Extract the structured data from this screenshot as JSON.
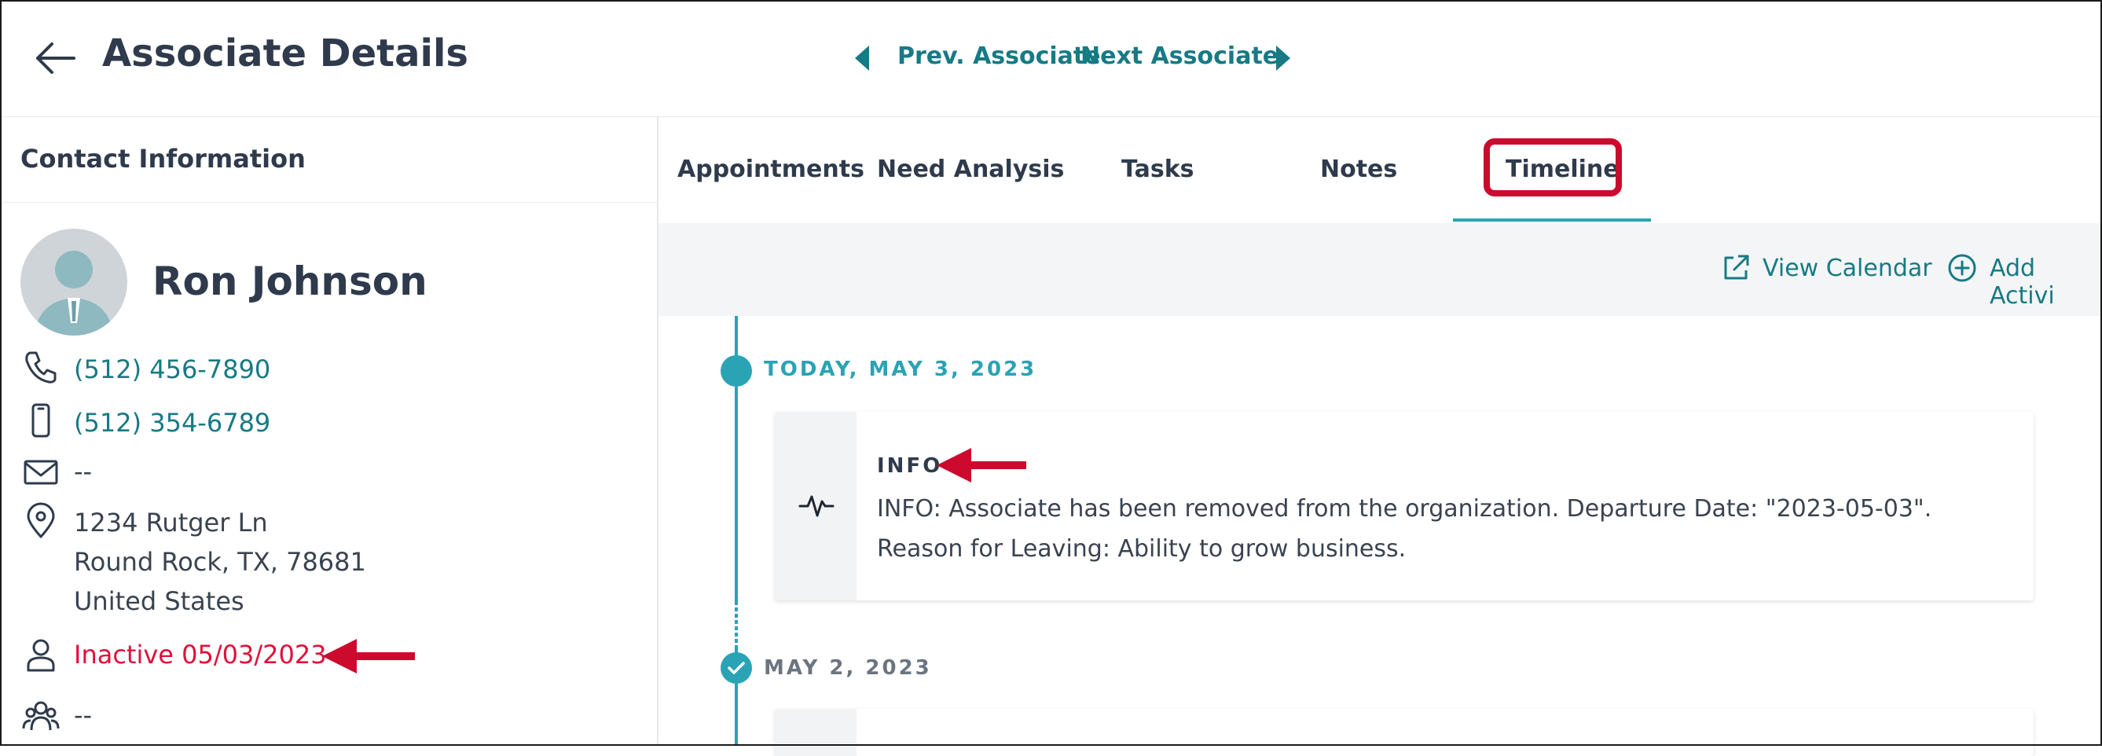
{
  "header": {
    "title": "Associate Details",
    "prev_label": "Prev. Associate",
    "next_label": "Next Associate"
  },
  "sidebar": {
    "heading": "Contact Information",
    "name": "Ron Johnson",
    "phone_primary": "(512) 456-7890",
    "phone_mobile": "(512) 354-6789",
    "email": "--",
    "address_line1": "1234 Rutger Ln",
    "address_line2": "Round Rock, TX, 78681",
    "address_line3": "United States",
    "status": "Inactive 05/03/2023",
    "team": "--"
  },
  "tabs": [
    {
      "label": "Appointments"
    },
    {
      "label": "Need Analysis"
    },
    {
      "label": "Tasks"
    },
    {
      "label": "Notes"
    },
    {
      "label": "Timeline",
      "active": true
    }
  ],
  "toolbar": {
    "view_calendar": "View Calendar",
    "add_activity": "Add Activi"
  },
  "timeline": [
    {
      "date": "TODAY, MAY 3, 2023",
      "kind": "INFO",
      "text": "INFO: Associate has been removed from the organization. Departure Date: \"2023-05-03\". Reason for Leaving: Ability to grow business."
    },
    {
      "date": "MAY 2, 2023"
    }
  ],
  "colors": {
    "accent": "#2aa3b5",
    "link": "#177a84",
    "inactive": "#e0103a",
    "highlight": "#cc0a2e"
  }
}
